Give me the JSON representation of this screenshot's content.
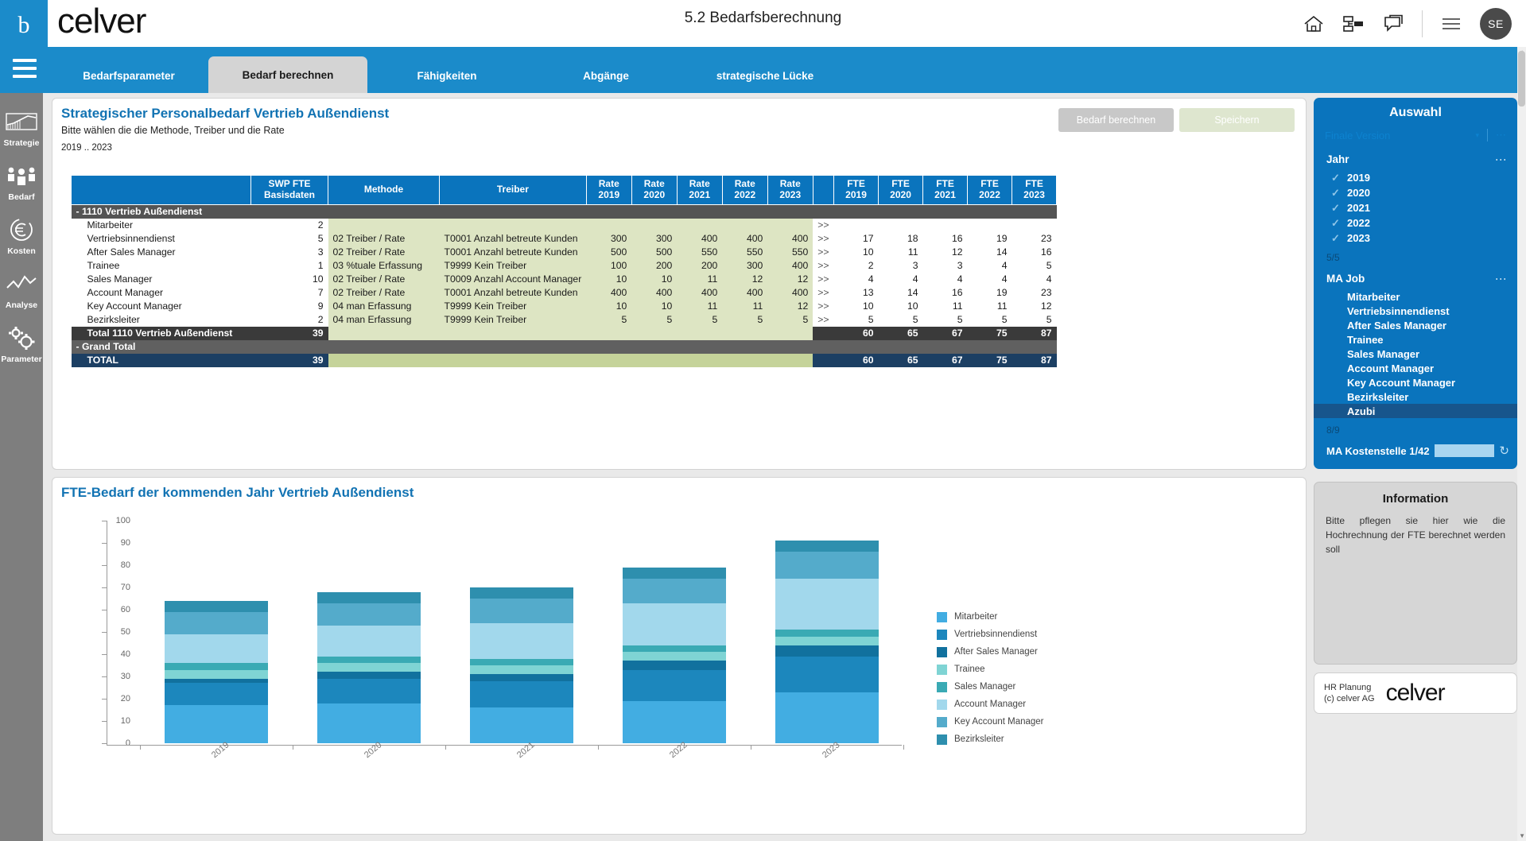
{
  "header": {
    "brand": "celver",
    "logo_mark": "b",
    "page_title": "5.2 Bedarfsberechnung",
    "icons": [
      "home-icon",
      "org-chart-icon",
      "chat-icon",
      "hamburger-icon"
    ],
    "avatar_initials": "SE"
  },
  "tabs": [
    {
      "label": "Bedarfsparameter",
      "active": false
    },
    {
      "label": "Bedarf berechnen",
      "active": true
    },
    {
      "label": "Fähigkeiten",
      "active": false
    },
    {
      "label": "Abgänge",
      "active": false
    },
    {
      "label": "strategische Lücke",
      "active": false
    }
  ],
  "rail": [
    {
      "label": "Strategie",
      "icon": "strategy-chart-icon"
    },
    {
      "label": "Bedarf",
      "icon": "people-group-icon"
    },
    {
      "label": "Kosten",
      "icon": "euro-circle-icon"
    },
    {
      "label": "Analyse",
      "icon": "line-chart-icon"
    },
    {
      "label": "Parameter",
      "icon": "gears-icon"
    }
  ],
  "table_panel": {
    "title": "Strategischer Personalbedarf Vertrieb Außendienst",
    "subtitle": "Bitte wählen die die Methode, Treiber und die Rate",
    "range": "2019 .. 2023",
    "btn_calculate": "Bedarf berechnen",
    "btn_save": "Speichern",
    "columns": {
      "name": "",
      "swp": "SWP FTE\nBasisdaten",
      "swp_l1": "SWP FTE",
      "swp_l2": "Basisdaten",
      "methode": "Methode",
      "treiber": "Treiber",
      "rates": [
        "Rate\n2019",
        "Rate\n2020",
        "Rate\n2021",
        "Rate\n2022",
        "Rate\n2023"
      ],
      "rate_label": "Rate",
      "fte_label": "FTE",
      "years": [
        "2019",
        "2020",
        "2021",
        "2022",
        "2023"
      ],
      "arrow": ""
    },
    "group_row": {
      "expander": "-",
      "label": "1110 Vertrieb Außendienst"
    },
    "rows": [
      {
        "name": "Mitarbeiter",
        "swp": "2",
        "methode": "",
        "treiber": "",
        "rates": [
          "",
          "",
          "",
          "",
          ""
        ],
        "arrow": ">>",
        "fte": [
          "",
          "",
          "",
          "",
          ""
        ]
      },
      {
        "name": "Vertriebsinnendienst",
        "swp": "5",
        "methode": "02 Treiber / Rate",
        "treiber": "T0001 Anzahl betreute Kunden",
        "rates": [
          "300",
          "300",
          "400",
          "400",
          "400"
        ],
        "arrow": ">>",
        "fte": [
          "17",
          "18",
          "16",
          "19",
          "23"
        ]
      },
      {
        "name": "After Sales Manager",
        "swp": "3",
        "methode": "02 Treiber / Rate",
        "treiber": "T0001 Anzahl betreute Kunden",
        "rates": [
          "500",
          "500",
          "550",
          "550",
          "550"
        ],
        "arrow": ">>",
        "fte": [
          "10",
          "11",
          "12",
          "14",
          "16"
        ]
      },
      {
        "name": "Trainee",
        "swp": "1",
        "methode": "03 %tuale Erfassung",
        "treiber": "T9999 Kein Treiber",
        "rates": [
          "100",
          "200",
          "200",
          "300",
          "400"
        ],
        "arrow": ">>",
        "fte": [
          "2",
          "3",
          "3",
          "4",
          "5"
        ]
      },
      {
        "name": "Sales Manager",
        "swp": "10",
        "methode": "02 Treiber / Rate",
        "treiber": "T0009 Anzahl Account Manager",
        "rates": [
          "10",
          "10",
          "11",
          "12",
          "12"
        ],
        "arrow": ">>",
        "fte": [
          "4",
          "4",
          "4",
          "4",
          "4"
        ]
      },
      {
        "name": "Account Manager",
        "swp": "7",
        "methode": "02 Treiber / Rate",
        "treiber": "T0001 Anzahl betreute Kunden",
        "rates": [
          "400",
          "400",
          "400",
          "400",
          "400"
        ],
        "arrow": ">>",
        "fte": [
          "13",
          "14",
          "16",
          "19",
          "23"
        ]
      },
      {
        "name": "Key Account Manager",
        "swp": "9",
        "methode": "04 man Erfassung",
        "treiber": "T9999 Kein Treiber",
        "rates": [
          "10",
          "10",
          "11",
          "11",
          "12"
        ],
        "arrow": ">>",
        "fte": [
          "10",
          "10",
          "11",
          "11",
          "12"
        ]
      },
      {
        "name": "Bezirksleiter",
        "swp": "2",
        "methode": "04 man Erfassung",
        "treiber": "T9999 Kein Treiber",
        "rates": [
          "5",
          "5",
          "5",
          "5",
          "5"
        ],
        "arrow": ">>",
        "fte": [
          "5",
          "5",
          "5",
          "5",
          "5"
        ]
      }
    ],
    "total_row": {
      "name": "Total 1110 Vertrieb Außendienst",
      "swp": "39",
      "fte": [
        "60",
        "65",
        "67",
        "75",
        "87"
      ]
    },
    "grand_row": {
      "expander": "-",
      "label": "Grand Total"
    },
    "grand_total_row": {
      "name": "TOTAL",
      "swp": "39",
      "fte": [
        "60",
        "65",
        "67",
        "75",
        "87"
      ]
    }
  },
  "chart_panel": {
    "title": "FTE-Bedarf der kommenden Jahr Vertrieb Außendienst"
  },
  "chart_data": {
    "type": "bar",
    "title": "FTE-Bedarf der kommenden Jahr Vertrieb Außendienst",
    "stacked": true,
    "categories": [
      "2019",
      "2020",
      "2021",
      "2022",
      "2023"
    ],
    "xlabel": "",
    "ylabel": "",
    "ylim": [
      0,
      100
    ],
    "yticks": [
      0,
      10,
      20,
      30,
      40,
      50,
      60,
      70,
      80,
      90,
      100
    ],
    "grid": false,
    "legend_position": "right",
    "series": [
      {
        "name": "Mitarbeiter",
        "color": "#42ADE2",
        "values": [
          17,
          18,
          16,
          19,
          23
        ]
      },
      {
        "name": "Vertriebsinnendienst",
        "color": "#1C87BD",
        "values": [
          10,
          11,
          12,
          14,
          16
        ]
      },
      {
        "name": "After Sales Manager",
        "color": "#11719E",
        "values": [
          2,
          3,
          3,
          4,
          5
        ]
      },
      {
        "name": "Trainee",
        "color": "#7FD4D4",
        "values": [
          4,
          4,
          4,
          4,
          4
        ]
      },
      {
        "name": "Sales Manager",
        "color": "#3AAAB4",
        "values": [
          3,
          3,
          3,
          3,
          3
        ]
      },
      {
        "name": "Account Manager",
        "color": "#A2D8EC",
        "values": [
          13,
          14,
          16,
          19,
          23
        ]
      },
      {
        "name": "Key Account Manager",
        "color": "#54ABCB",
        "values": [
          10,
          10,
          11,
          11,
          12
        ]
      },
      {
        "name": "Bezirksleiter",
        "color": "#2E8FAE",
        "values": [
          5,
          5,
          5,
          5,
          5
        ]
      }
    ],
    "totals": [
      60,
      65,
      67,
      75,
      87
    ]
  },
  "selection": {
    "title": "Auswahl",
    "version_value": "Finale Version",
    "version_caret": "▾",
    "version_dots": "⋯",
    "sections": [
      {
        "title": "Jahr",
        "kebab": "⋮",
        "items": [
          {
            "label": "2019",
            "checked": true
          },
          {
            "label": "2020",
            "checked": true
          },
          {
            "label": "2021",
            "checked": true
          },
          {
            "label": "2022",
            "checked": true
          },
          {
            "label": "2023",
            "checked": true
          }
        ],
        "count": "5/5"
      },
      {
        "title": "MA Job",
        "kebab": "⋮",
        "items": [
          {
            "label": "Mitarbeiter",
            "selected": false
          },
          {
            "label": "Vertriebsinnendienst",
            "selected": false
          },
          {
            "label": "After Sales Manager",
            "selected": false
          },
          {
            "label": "Trainee",
            "selected": false
          },
          {
            "label": "Sales Manager",
            "selected": false
          },
          {
            "label": "Account Manager",
            "selected": false
          },
          {
            "label": "Key Account Manager",
            "selected": false
          },
          {
            "label": "Bezirksleiter",
            "selected": false
          },
          {
            "label": "Azubi",
            "selected": true
          }
        ],
        "count": "8/9"
      }
    ],
    "kostenstelle_label": "MA Kostenstelle 1/42",
    "kostenstelle_refresh": "↻"
  },
  "information": {
    "title": "Information",
    "body": "Bitte pflegen sie hier wie die Hochrechnung der FTE berechnet werden soll"
  },
  "footer": {
    "line1": "HR Planung",
    "line2": "(c) celver AG",
    "logo": "celver"
  },
  "colors": {
    "brand_blue": "#1b8bca",
    "header_blue": "#0a74bd",
    "green_zone": "#dde5c3",
    "group_gray": "#545454",
    "grand_navy": "#1c3f63"
  }
}
